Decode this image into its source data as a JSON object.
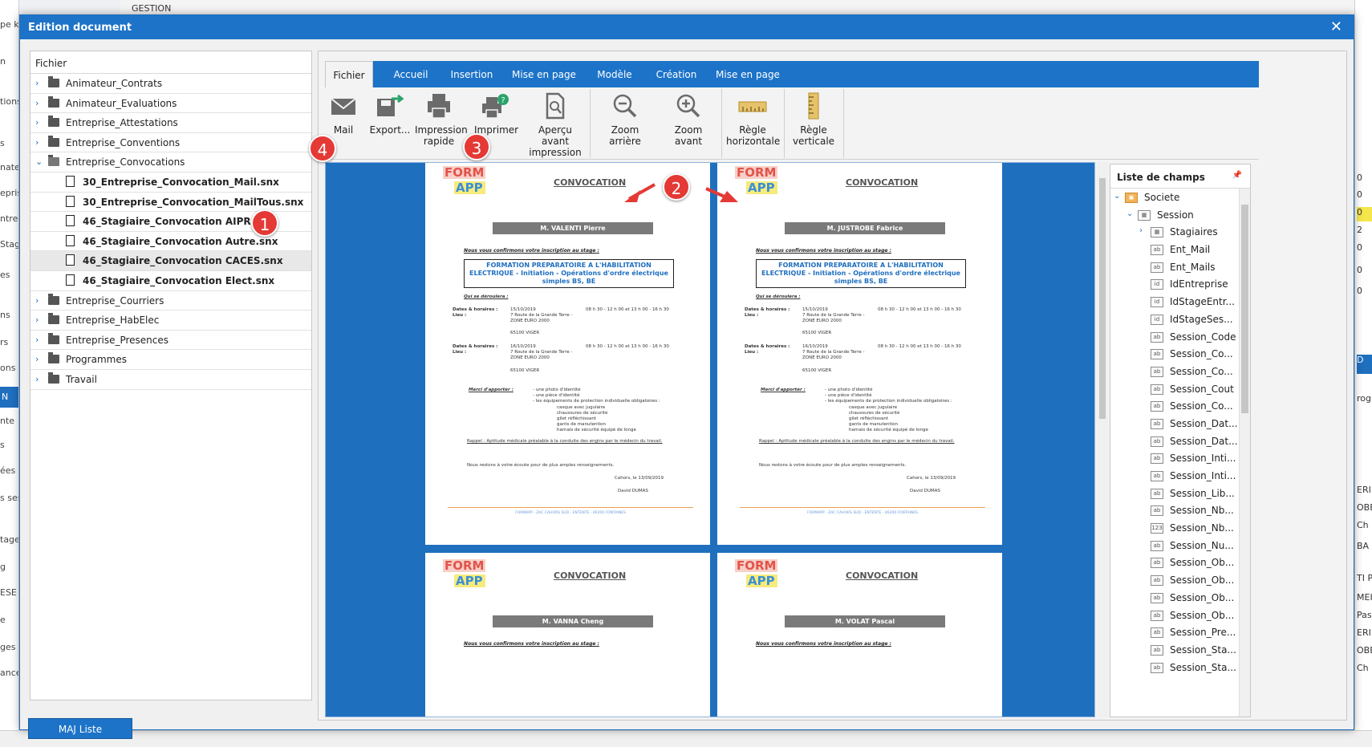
{
  "background": {
    "top_label": "GESTION",
    "left_snippets": [
      "pe k",
      "n",
      "tions",
      "s",
      "nate",
      "epris",
      "ntre",
      "Stagi",
      "es",
      "ns",
      "rs",
      "ons",
      "N",
      "nte",
      "s",
      "ées",
      "s sess",
      "tage",
      "g",
      "ESE",
      "e",
      "ges",
      "ances"
    ],
    "right_snippets": [
      "0",
      "0",
      "0",
      "2",
      "0",
      "0",
      "0",
      "D",
      "rogr",
      "ERI",
      "OBE",
      "Ch",
      "BA",
      "TI P",
      "MEI",
      "Pas",
      "ERI",
      "OBE",
      "Ch"
    ]
  },
  "dialog": {
    "title": "Edition document",
    "close_label": "✕"
  },
  "file_panel": {
    "header": "Fichier",
    "items": [
      {
        "label": "Animateur_Contrats",
        "type": "folder",
        "expanded": false
      },
      {
        "label": "Animateur_Evaluations",
        "type": "folder",
        "expanded": false
      },
      {
        "label": "Entreprise_Attestations",
        "type": "folder",
        "expanded": false
      },
      {
        "label": "Entreprise_Conventions",
        "type": "folder",
        "expanded": false
      },
      {
        "label": "Entreprise_Convocations",
        "type": "folder",
        "expanded": true
      },
      {
        "label": "30_Entreprise_Convocation_Mail.snx",
        "type": "file"
      },
      {
        "label": "30_Entreprise_Convocation_MailTous.snx",
        "type": "file"
      },
      {
        "label": "46_Stagiaire_Convocation AIPR.snx",
        "type": "file"
      },
      {
        "label": "46_Stagiaire_Convocation Autre.snx",
        "type": "file"
      },
      {
        "label": "46_Stagiaire_Convocation CACES.snx",
        "type": "file",
        "selected": true
      },
      {
        "label": "46_Stagiaire_Convocation Elect.snx",
        "type": "file"
      },
      {
        "label": "Entreprise_Courriers",
        "type": "folder",
        "expanded": false
      },
      {
        "label": "Entreprise_HabElec",
        "type": "folder",
        "expanded": false
      },
      {
        "label": "Entreprise_Presences",
        "type": "folder",
        "expanded": false
      },
      {
        "label": "Programmes",
        "type": "folder",
        "expanded": false
      },
      {
        "label": "Travail",
        "type": "folder",
        "expanded": false
      }
    ],
    "maj_button": "MAJ Liste"
  },
  "tabs": [
    "Fichier",
    "Accueil",
    "Insertion",
    "Mise en page",
    "Modèle",
    "Création",
    "Mise en page"
  ],
  "active_tab": "Fichier",
  "ribbon": {
    "mail": "Mail",
    "export": "Export...",
    "quick_print_1": "Impression",
    "quick_print_2": "rapide",
    "print": "Imprimer",
    "preview_1": "Aperçu avant",
    "preview_2": "impression",
    "zoom_out": "Zoom arrière",
    "zoom_in": "Zoom avant",
    "hruler_1": "Règle",
    "hruler_2": "horizontale",
    "vruler_1": "Règle",
    "vruler_2": "verticale"
  },
  "pages": [
    {
      "name": "M. VALENTI Pierre"
    },
    {
      "name": "M. JUSTROBE Fabrice"
    },
    {
      "name": "M. VANNA Cheng"
    },
    {
      "name": "M. VOLAT Pascal"
    }
  ],
  "page_common": {
    "logo_top": "FORM",
    "logo_bottom": "APP",
    "title": "CONVOCATION",
    "confirm": "Nous vous confirmons votre inscription au stage :",
    "formation_1": "FORMATION PREPARATOIRE A L'HABILITATION",
    "formation_2": "ELECTRIQUE - Initiation - Opérations d'ordre électrique",
    "formation_3": "simples BS, BE",
    "deroulera": "Qui se déroulera :",
    "dates_label": "Dates & horaires :",
    "lieu_label": "Lieu :",
    "date1": "15/10/2019",
    "date2": "16/10/2019",
    "hours": "08 h 30 - 12 h 00 et 13 h 00 - 16 h 30",
    "addr1": "7 Route de la Grande Terre -",
    "addr2": "ZONE EURO 2000",
    "city": "65100 VIGER",
    "apporter": "Merci d'apporter :",
    "list1": "- une photo d'identité",
    "list2": "- une pièce d'identité",
    "list3": "- les équipements de protection individuelle obligatoires :",
    "sub1": "casque avec jugulaire",
    "sub2": "chaussures de sécurité",
    "sub3": "gilet réfléchissant",
    "sub4": "gants de manutention",
    "sub5": "harnais de sécurité équipé de longe",
    "rappel": "Rappel : Aptitude médicale préalable à la conduite des engins par le médecin du travail.",
    "ecoute": "Nous restons à votre écoute pour de plus amples renseignements.",
    "lieu_date": "Cahors, le 13/09/2019",
    "signature": "David DUMAS",
    "footer": "FORMAPP - ZAC CAHORS SUD - ENTENTE - 46200 FONTAINES"
  },
  "fields_panel": {
    "header": "Liste de champs",
    "pin": "📌",
    "items": [
      {
        "label": "Societe",
        "level": 0,
        "icon": "db"
      },
      {
        "label": "Session",
        "level": 1,
        "icon": "table"
      },
      {
        "label": "Stagiaires",
        "level": 2,
        "icon": "table"
      },
      {
        "label": "Ent_Mail",
        "level": 2,
        "icon": "ab"
      },
      {
        "label": "Ent_Mails",
        "level": 2,
        "icon": "ab"
      },
      {
        "label": "IdEntreprise",
        "level": 2,
        "icon": "id"
      },
      {
        "label": "IdStageEntr...",
        "level": 2,
        "icon": "id"
      },
      {
        "label": "IdStageSes...",
        "level": 2,
        "icon": "id"
      },
      {
        "label": "Session_Code",
        "level": 2,
        "icon": "ab"
      },
      {
        "label": "Session_Co...",
        "level": 2,
        "icon": "ab"
      },
      {
        "label": "Session_Co...",
        "level": 2,
        "icon": "ab"
      },
      {
        "label": "Session_Cout",
        "level": 2,
        "icon": "ab"
      },
      {
        "label": "Session_Co...",
        "level": 2,
        "icon": "ab"
      },
      {
        "label": "Session_Dat...",
        "level": 2,
        "icon": "ab"
      },
      {
        "label": "Session_Dat...",
        "level": 2,
        "icon": "ab"
      },
      {
        "label": "Session_Inti...",
        "level": 2,
        "icon": "ab"
      },
      {
        "label": "Session_Inti...",
        "level": 2,
        "icon": "ab"
      },
      {
        "label": "Session_Lib...",
        "level": 2,
        "icon": "ab"
      },
      {
        "label": "Session_Nb...",
        "level": 2,
        "icon": "ab"
      },
      {
        "label": "Session_Nb...",
        "level": 2,
        "icon": "123"
      },
      {
        "label": "Session_Nu...",
        "level": 2,
        "icon": "ab"
      },
      {
        "label": "Session_Ob...",
        "level": 2,
        "icon": "ab"
      },
      {
        "label": "Session_Ob...",
        "level": 2,
        "icon": "ab"
      },
      {
        "label": "Session_Ob...",
        "level": 2,
        "icon": "ab"
      },
      {
        "label": "Session_Ob...",
        "level": 2,
        "icon": "ab"
      },
      {
        "label": "Session_Pre...",
        "level": 2,
        "icon": "ab"
      },
      {
        "label": "Session_Sta...",
        "level": 2,
        "icon": "ab"
      },
      {
        "label": "Session_Sta...",
        "level": 2,
        "icon": "ab"
      }
    ]
  },
  "markers": [
    "1",
    "2",
    "3",
    "4"
  ],
  "colors": {
    "accent": "#1d73c8",
    "marker": "#e53935",
    "preview_bg": "#1f6fbf"
  }
}
